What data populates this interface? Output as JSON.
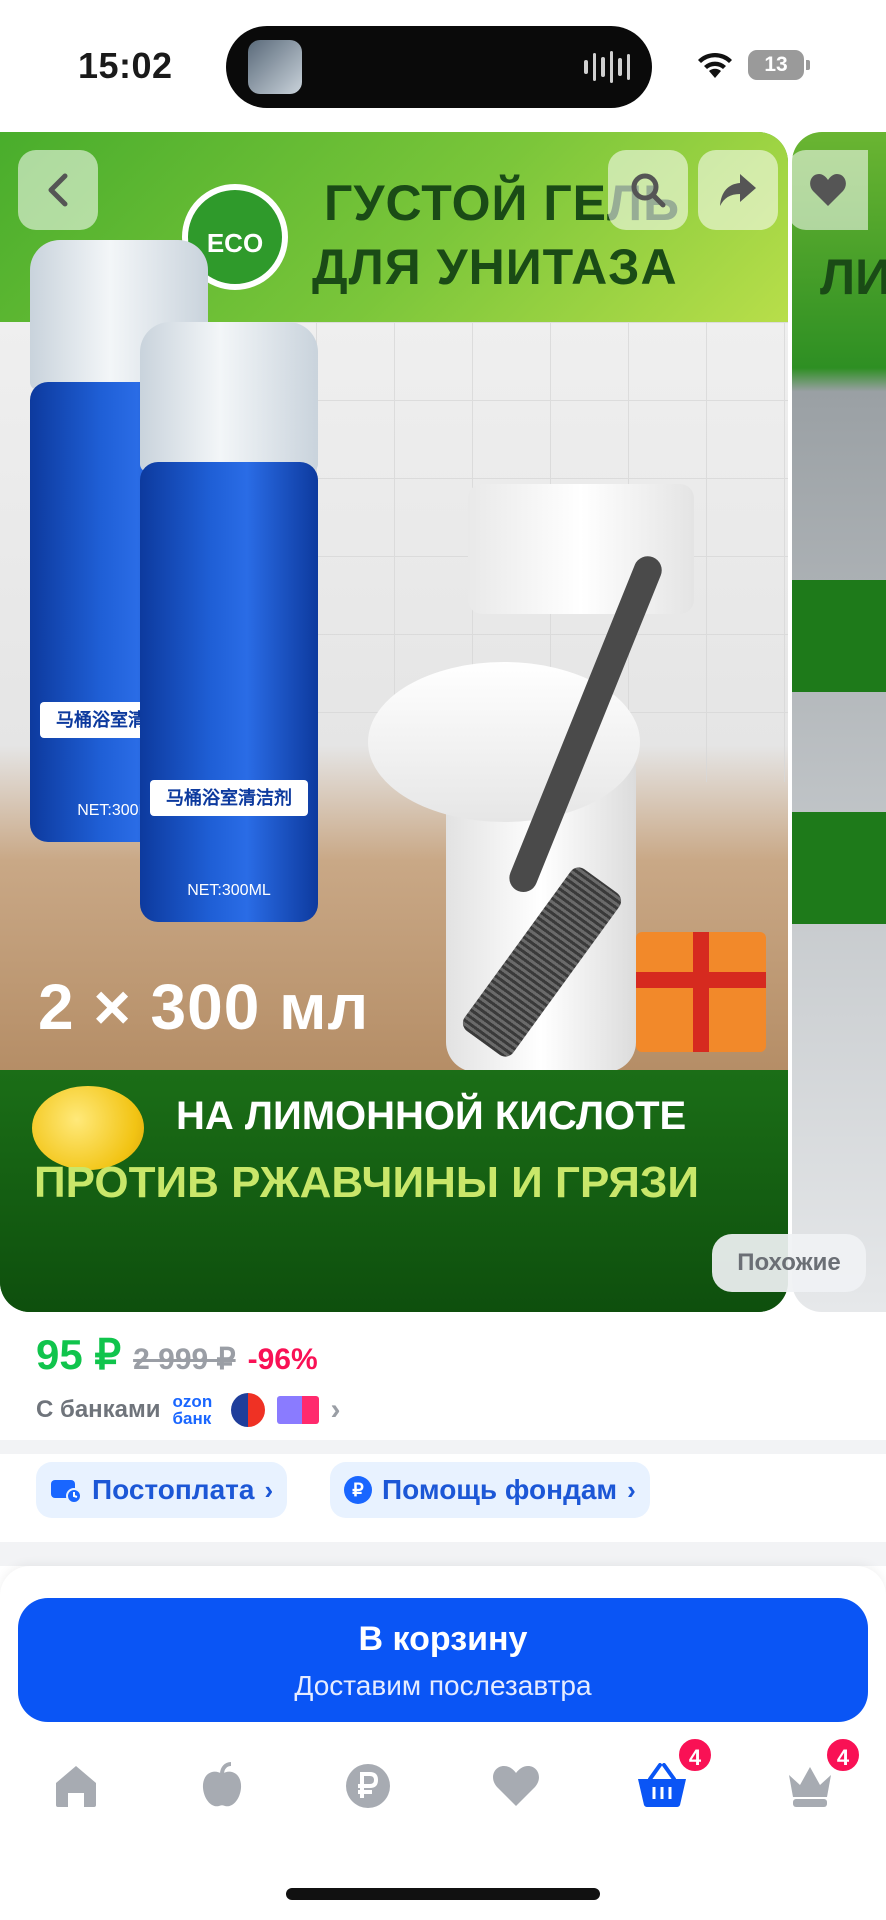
{
  "status_bar": {
    "time": "15:02",
    "battery": "13"
  },
  "product_image": {
    "headline_line1": "ГУСТОЙ ГЕЛЬ",
    "headline_line2": "ДЛЯ УНИТАЗА",
    "eco_badge": "ECO",
    "can_label": "马桶浴室清洁剂",
    "can_volume": "NET:300ML",
    "volume": "2 × 300 мл",
    "feature1": "НА ЛИМОННОЙ КИСЛОТЕ",
    "feature2": "ПРОТИВ РЖАВЧИНЫ И ГРЯЗИ",
    "next_image_title": "ЛИ"
  },
  "overlay_buttons": {
    "back": "chevron-left-icon",
    "search": "search-icon",
    "share": "share-icon",
    "favorite": "heart-icon"
  },
  "similar_label": "Похожие",
  "price": {
    "current": "95 ₽",
    "old": "2 999 ₽",
    "discount": "-96%"
  },
  "banks": {
    "label": "С банками",
    "ozon_line1": "ozon",
    "ozon_line2": "банк"
  },
  "chips": [
    {
      "label": "Постоплата",
      "icon": "wallet-clock-icon"
    },
    {
      "label": "Помощь фондам",
      "icon": "ruble-coin-icon"
    }
  ],
  "cart": {
    "title": "В корзину",
    "subtitle": "Доставим послезавтра"
  },
  "tabbar": {
    "items": [
      {
        "icon": "home-icon"
      },
      {
        "icon": "apple-icon"
      },
      {
        "icon": "ruble-icon"
      },
      {
        "icon": "heart-icon"
      },
      {
        "icon": "basket-icon",
        "badge": "4",
        "active": true
      },
      {
        "icon": "crown-icon",
        "badge": "4"
      }
    ]
  },
  "colors": {
    "accent": "#0a55f5",
    "price": "#10c44c",
    "discount": "#f91155",
    "chip_bg": "#e8f2ff"
  }
}
